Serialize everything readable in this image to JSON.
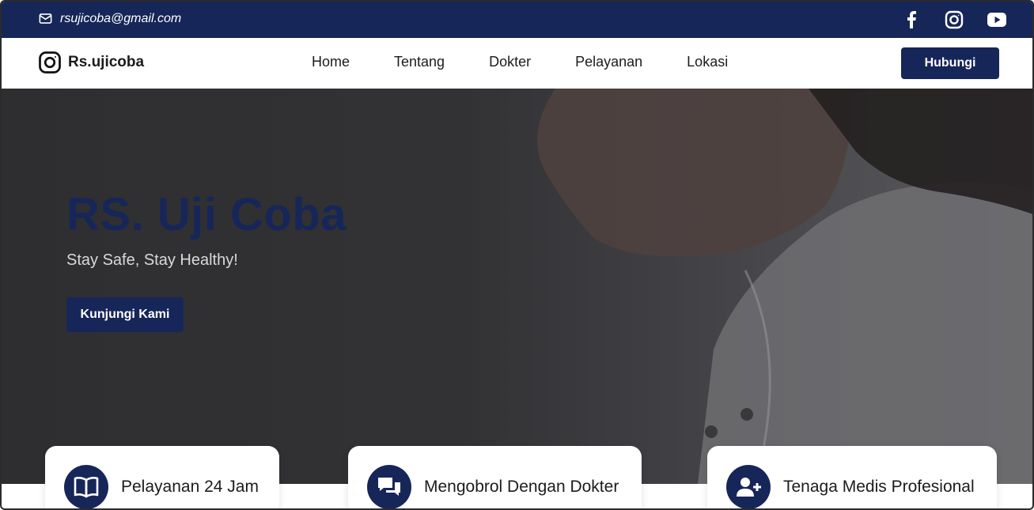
{
  "topbar": {
    "email": "rsujicoba@gmail.com",
    "socials": [
      "facebook-icon",
      "instagram-icon",
      "youtube-icon"
    ]
  },
  "navbar": {
    "brand": "Rs.ujicoba",
    "menu": [
      "Home",
      "Tentang",
      "Dokter",
      "Pelayanan",
      "Lokasi"
    ],
    "cta": "Hubungi"
  },
  "hero": {
    "title": "RS. Uji Coba",
    "subtitle": "Stay Safe, Stay Healthy!",
    "button": "Kunjungi Kami"
  },
  "features": [
    {
      "icon": "book-icon",
      "label": "Pelayanan 24 Jam"
    },
    {
      "icon": "chat-icon",
      "label": "Mengobrol Dengan Dokter"
    },
    {
      "icon": "user-plus-icon",
      "label": "Tenaga Medis Profesional"
    }
  ],
  "colors": {
    "primary": "#172659",
    "white": "#ffffff"
  }
}
